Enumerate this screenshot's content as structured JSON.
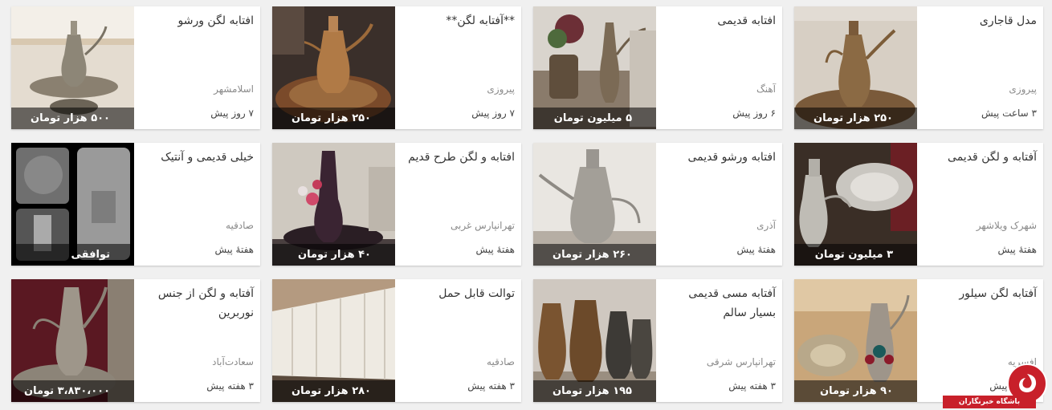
{
  "listings": [
    {
      "title": "مدل قاجاری",
      "location": "پیروزی",
      "time": "۳ ساعت پیش",
      "price": "۲۵۰ هزار تومان"
    },
    {
      "title": "افتابه قدیمی",
      "location": "آهنگ",
      "time": "۶ روز پیش",
      "price": "۵ میلیون تومان"
    },
    {
      "title": "**آفتابه لگن**",
      "location": "پیروزی",
      "time": "۷ روز پیش",
      "price": "۲۵۰ هزار تومان"
    },
    {
      "title": "افتابه لگن ورشو",
      "location": "اسلامشهر",
      "time": "۷ روز پیش",
      "price": "۵۰۰ هزار تومان"
    },
    {
      "title": "آفتابه و لگن قدیمی",
      "location": "شهرک ویلاشهر",
      "time": "هفتهٔ پیش",
      "price": "۳ میلیون تومان"
    },
    {
      "title": "افتابه ورشو قدیمی",
      "location": "آذری",
      "time": "هفتهٔ پیش",
      "price": "۲۶۰ هزار تومان"
    },
    {
      "title": "افتابه و لگن طرح قدیم",
      "location": "تهرانپارس غربی",
      "time": "هفتهٔ پیش",
      "price": "۴۰ هزار تومان"
    },
    {
      "title": "خیلی قدیمی و آنتیک",
      "location": "صادقیه",
      "time": "هفتهٔ پیش",
      "price": "توافقی"
    },
    {
      "title": "آفتابه لگن سیلور",
      "location": "افسریه",
      "time": "۳ هفته پیش",
      "price": "۹۰ هزار تومان"
    },
    {
      "title": "آفتابه مسی قدیمی بسیار سالم",
      "location": "تهرانپارس شرقی",
      "time": "۳ هفته پیش",
      "price": "۱۹۵ هزار تومان"
    },
    {
      "title": "توالت قابل حمل",
      "location": "صادقیه",
      "time": "۳ هفته پیش",
      "price": "۲۸۰ هزار تومان"
    },
    {
      "title": "آفتابه و لگن از جنس نوربرین",
      "location": "سعادت‌آباد",
      "time": "۳ هفته پیش",
      "price": "۳،۸۳۰،۰۰۰ تومان"
    }
  ],
  "watermark": {
    "text": "باشگاه خبرنگاران"
  }
}
